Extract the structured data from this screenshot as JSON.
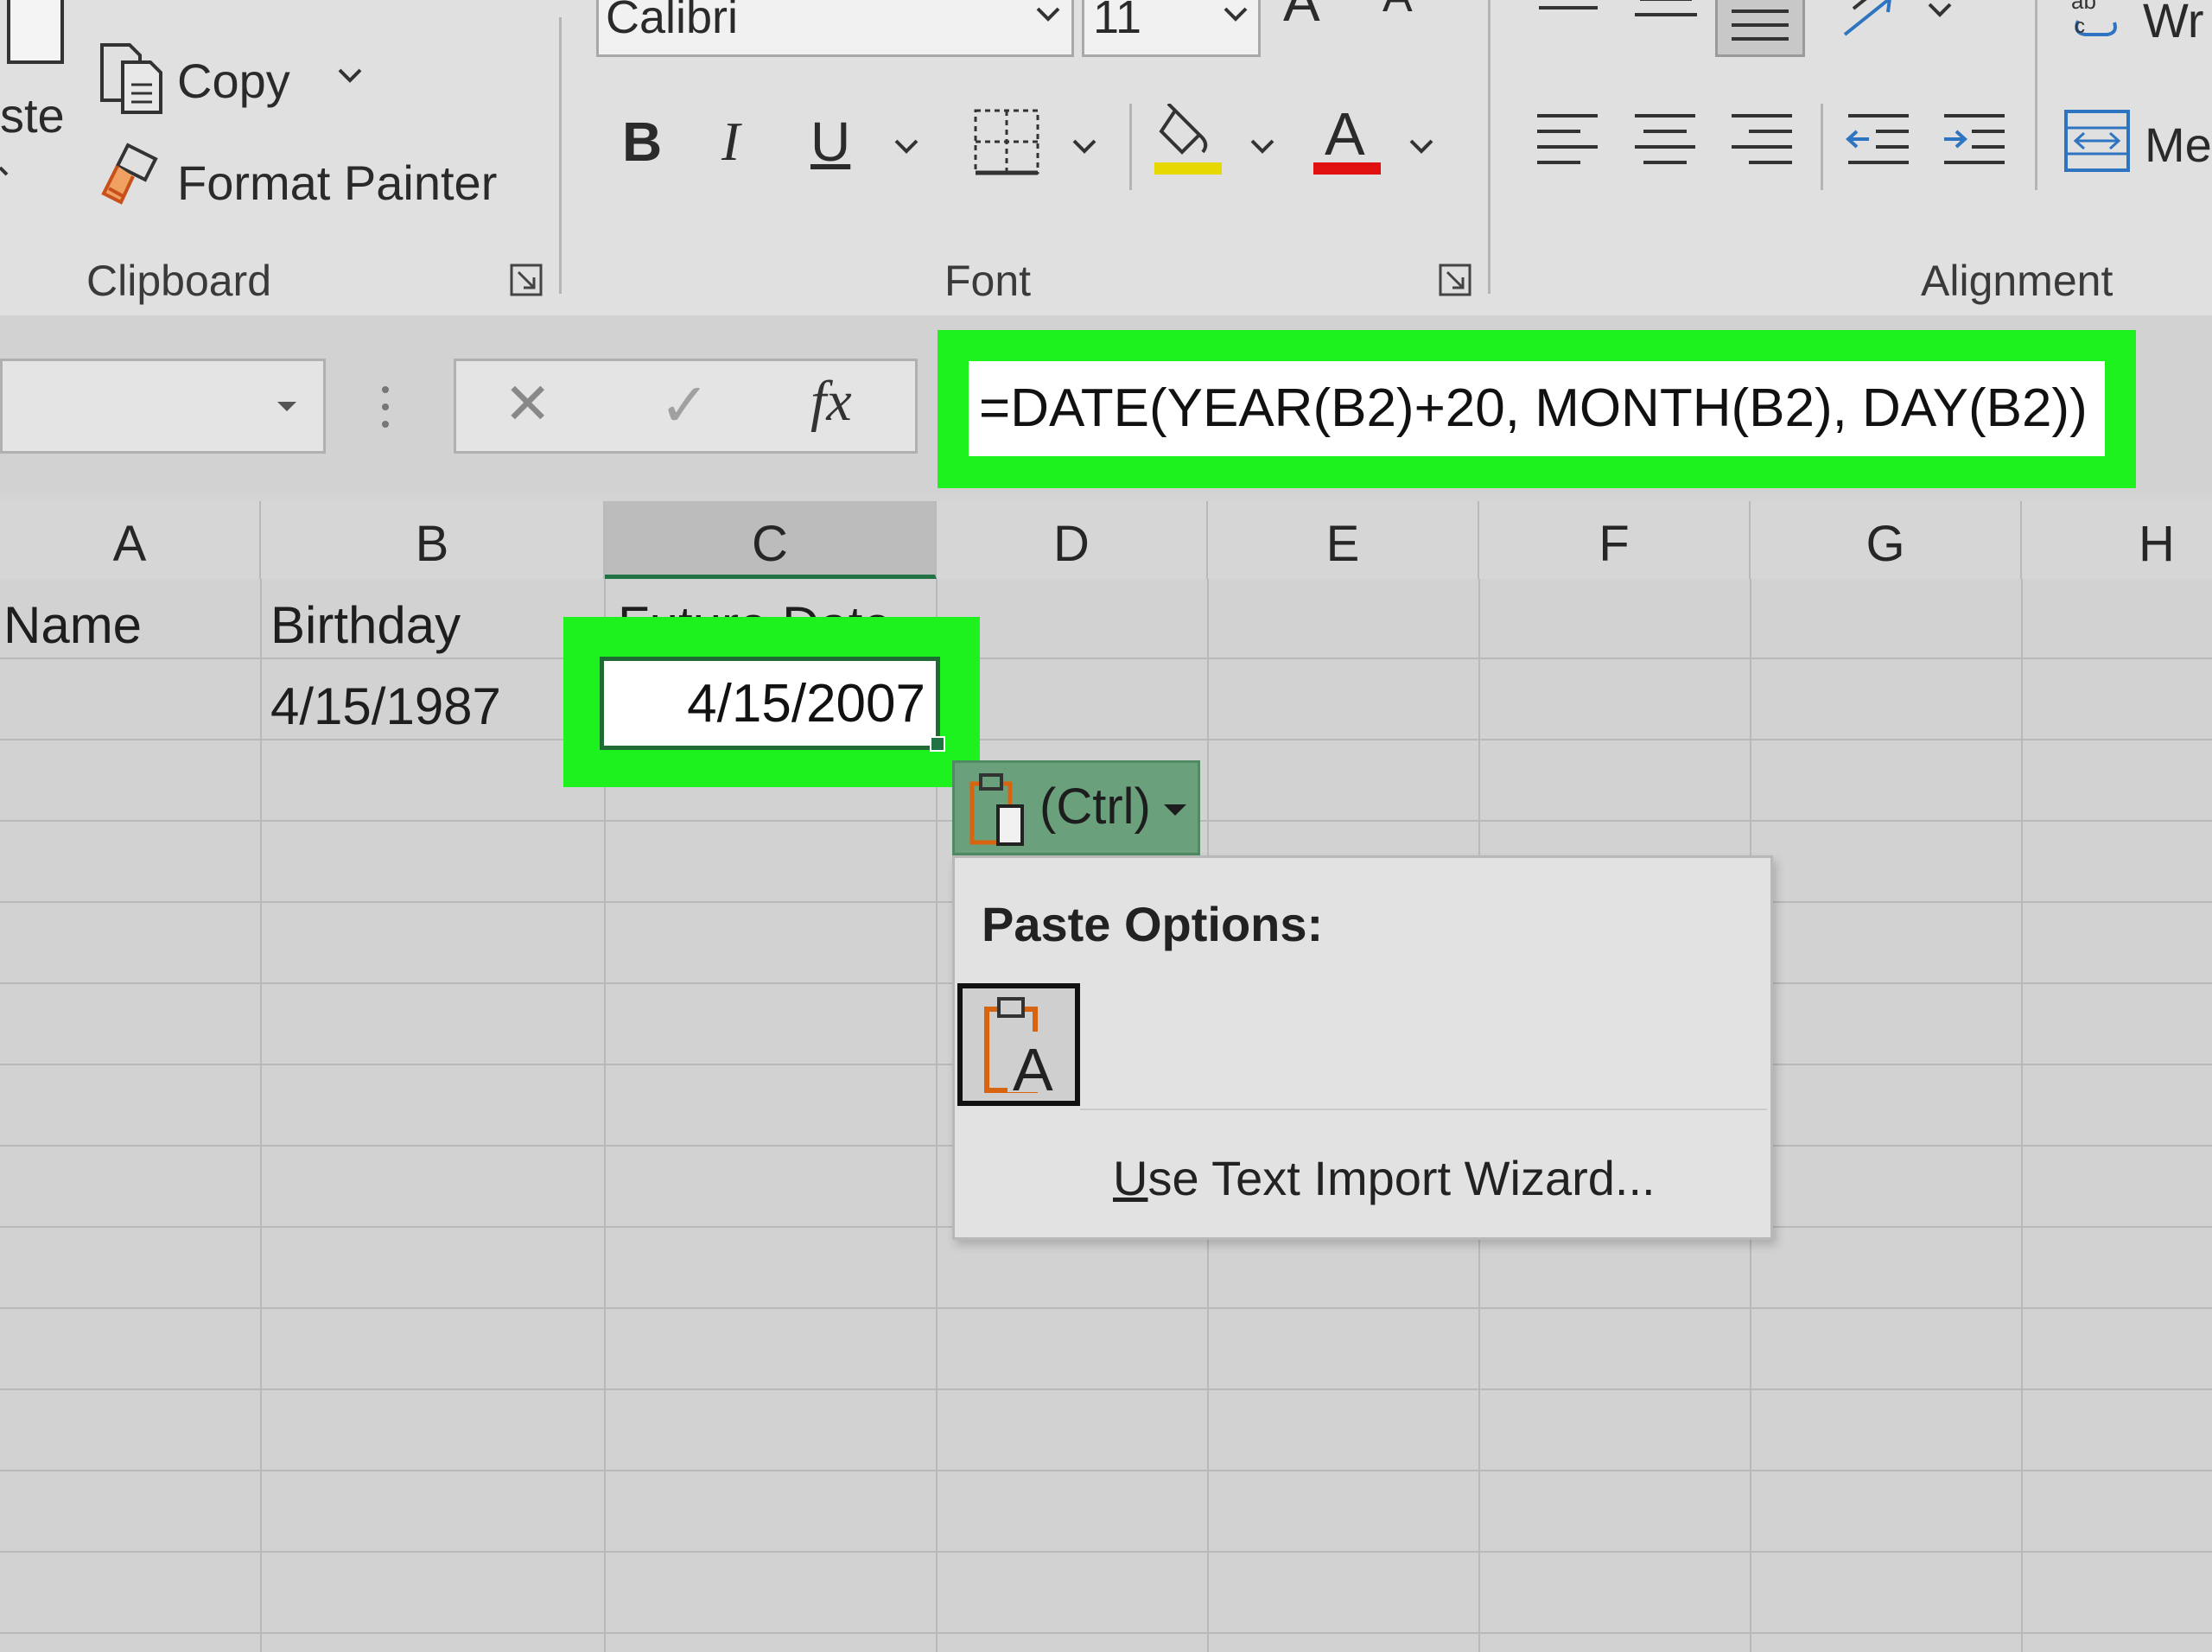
{
  "ribbon": {
    "paste_label_partial": "ste",
    "copy_label": "Copy",
    "format_painter_label": "Format Painter",
    "clipboard_group": "Clipboard",
    "font_name": "Calibri",
    "font_size": "11",
    "grow_font_glyph": "A",
    "shrink_font_glyph": "A",
    "bold_glyph": "B",
    "italic_glyph": "I",
    "underline_glyph": "U",
    "font_color_glyph": "A",
    "font_group": "Font",
    "alignment_group": "Alignment",
    "wrap_text_partial": "Wr",
    "merge_partial": "Me",
    "highlight_color": "#e6d800",
    "font_color": "#e01010"
  },
  "formula_bar": {
    "formula": "=DATE(YEAR(B2)+20, MONTH(B2), DAY(B2))",
    "cancel_glyph": "✕",
    "enter_glyph": "✓",
    "fx_label": "fx"
  },
  "columns": [
    "A",
    "B",
    "C",
    "D",
    "E",
    "F",
    "G",
    "H"
  ],
  "cells": {
    "a1": "Name",
    "b1": "Birthday",
    "c1": "Future Date",
    "b2": "4/15/1987",
    "c2": "4/15/2007"
  },
  "paste_options": {
    "ctrl_label": "(Ctrl)",
    "title": "Paste Options:",
    "wizard_accel": "U",
    "wizard_rest": "se Text Import Wizard..."
  },
  "highlight_color": "#1ef21e"
}
